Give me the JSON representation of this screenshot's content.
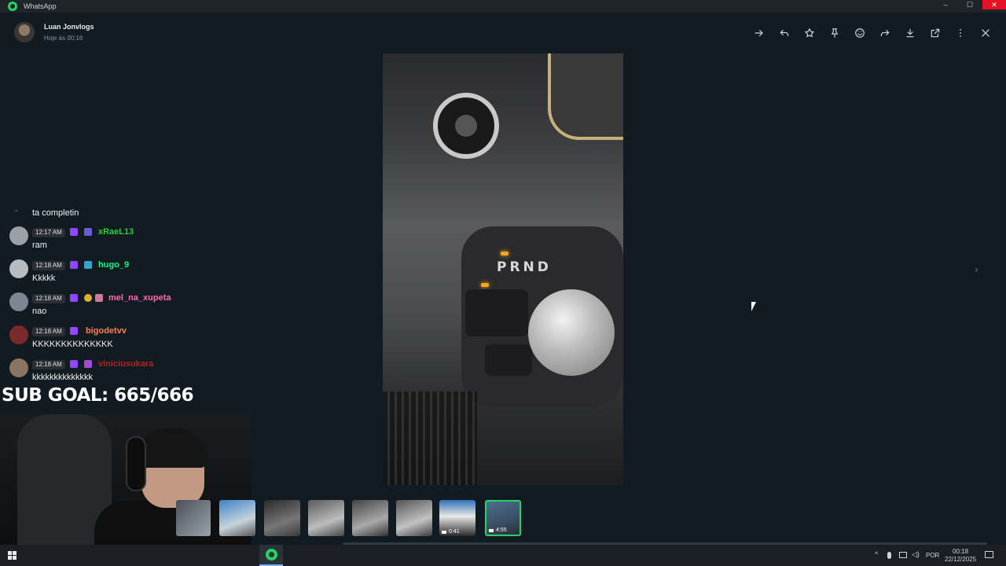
{
  "window": {
    "title": "WhatsApp",
    "minimize": "–",
    "maximize": "☐",
    "close": "✕"
  },
  "header": {
    "contact_name": "Luan Jonvlogs",
    "timestamp": "Hoje às 00:16",
    "icons": [
      "arrow-right-icon",
      "reply-icon",
      "star-icon",
      "pin-icon",
      "emoji-icon",
      "forward-icon",
      "download-icon",
      "open-external-icon",
      "more-icon",
      "close-icon"
    ]
  },
  "media": {
    "gear_letters": "PRND"
  },
  "chat": {
    "first_line": "ta completin",
    "messages": [
      {
        "time": "12:17 AM",
        "user": "xRaeL13",
        "color": "#2ecc40",
        "text": "ram"
      },
      {
        "time": "12:18 AM",
        "user": "hugo_9",
        "color": "#00ff7f",
        "text": "Kkkkk"
      },
      {
        "time": "12:18 AM",
        "user": "mel_na_xupeta",
        "color": "#ff69b4",
        "text": "nao"
      },
      {
        "time": "12:18 AM",
        "user": "bigodetvv",
        "color": "#ff7f50",
        "text": "KKKKKKKKKKKKKK"
      },
      {
        "time": "12:18 AM",
        "user": "viniciusukara",
        "color": "#b22222",
        "text": "kkkkkkkkkkkkkk"
      }
    ]
  },
  "overlay": {
    "sub_goal": "SUB GOAL: 665/666"
  },
  "thumbnails": [
    {
      "duration": ""
    },
    {
      "duration": ""
    },
    {
      "duration": ""
    },
    {
      "duration": ""
    },
    {
      "duration": ""
    },
    {
      "duration": ""
    },
    {
      "duration": "0:41"
    },
    {
      "duration": "4:55",
      "active": true
    }
  ],
  "taskbar": {
    "language": "POR",
    "time": "00:18",
    "date": "22/12/2025"
  },
  "colors": {
    "accent": "#25d366",
    "background": "#111b21"
  }
}
